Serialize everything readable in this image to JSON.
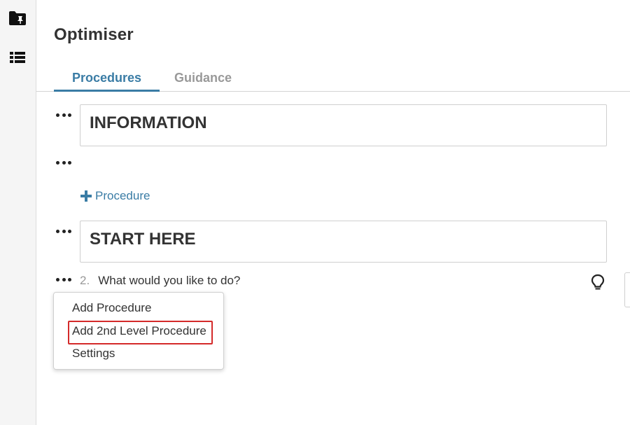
{
  "app": {
    "title": "Optimiser"
  },
  "sidebar": {
    "items": [
      {
        "icon": "folder-pin-icon"
      },
      {
        "icon": "list-icon"
      }
    ]
  },
  "tabs": [
    {
      "label": "Procedures",
      "active": true
    },
    {
      "label": "Guidance",
      "active": false
    }
  ],
  "sections": [
    {
      "title": "INFORMATION"
    },
    {
      "title": "START HERE"
    }
  ],
  "add_procedure": {
    "label": "Procedure",
    "icon": "plus-icon"
  },
  "procedure": {
    "number": "2.",
    "text": "What would you like to do?"
  },
  "context_menu": {
    "items": [
      {
        "label": "Add Procedure"
      },
      {
        "label": "Add 2nd Level Procedure",
        "highlighted": true
      },
      {
        "label": "Settings"
      }
    ]
  },
  "colors": {
    "accent": "#3a7ca5",
    "highlight": "#d42a2a",
    "muted": "#999999",
    "text": "#333333"
  }
}
